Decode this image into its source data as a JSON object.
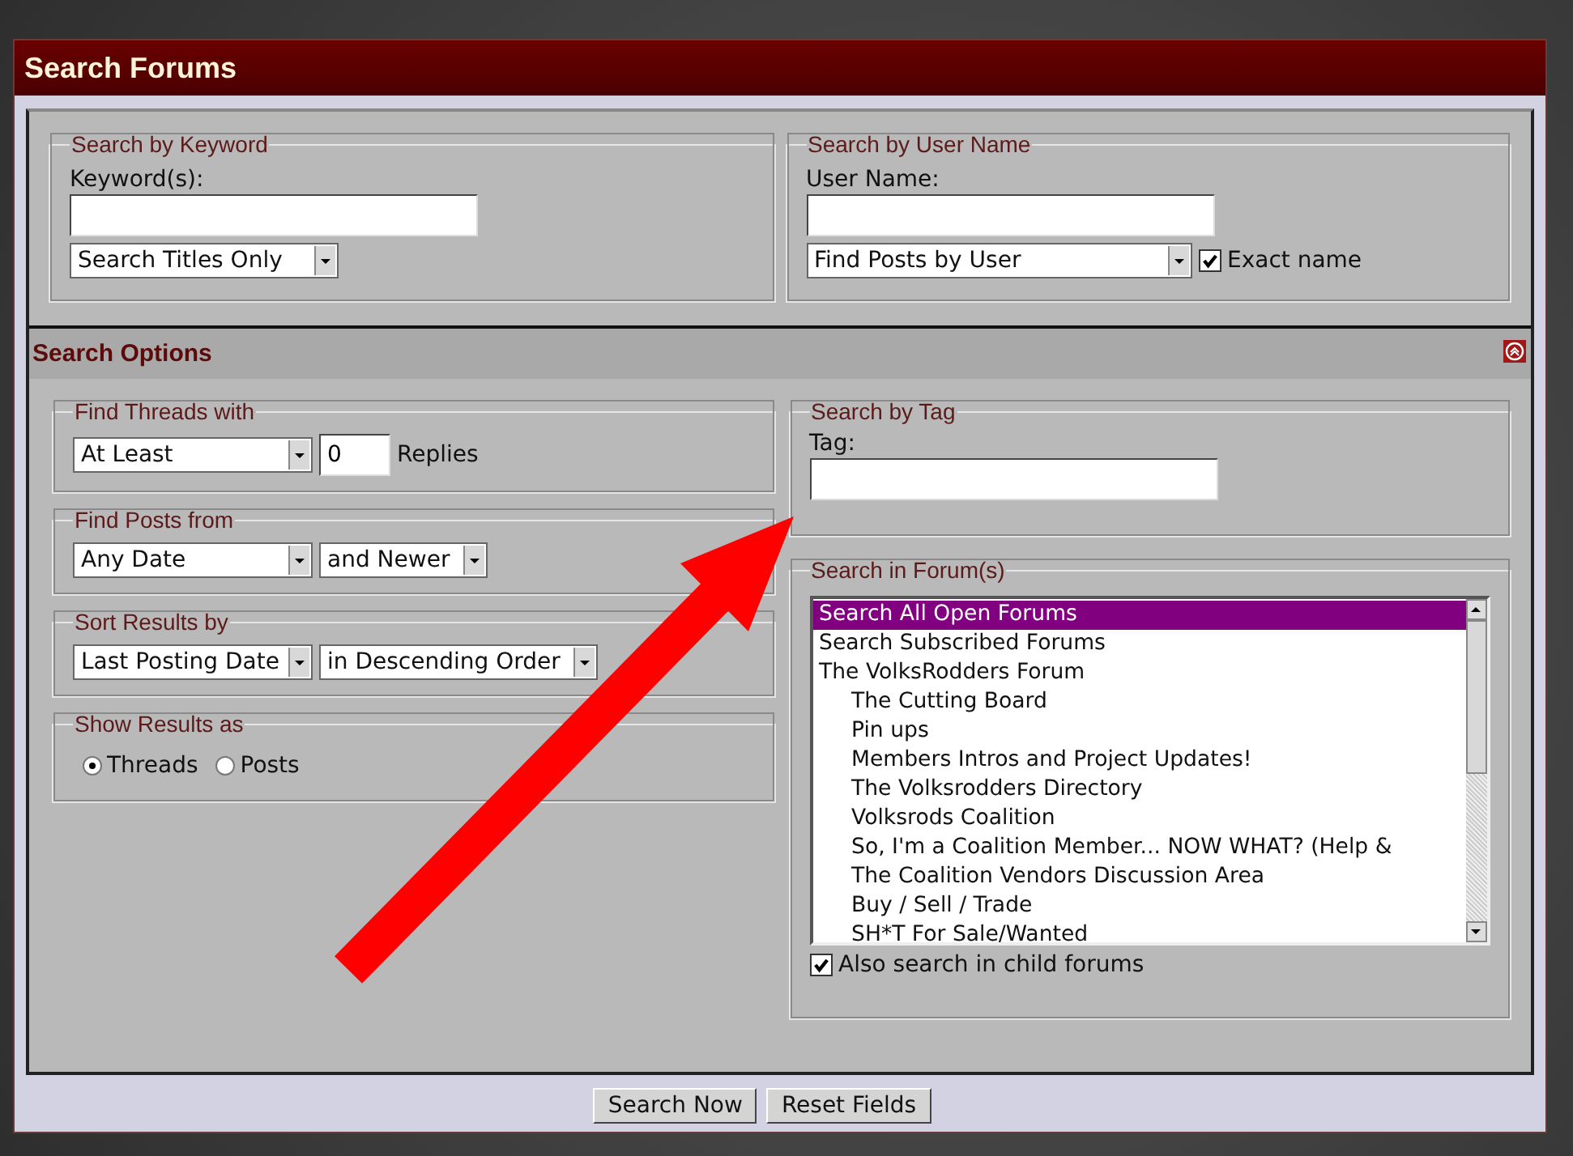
{
  "window": {
    "title": "Search Forums"
  },
  "keyword_section": {
    "legend": "Search by Keyword",
    "label": "Keyword(s):",
    "mode_select": "Search Titles Only"
  },
  "user_section": {
    "legend": "Search by User Name",
    "label": "User Name:",
    "mode_select": "Find Posts by User",
    "exact_name": {
      "label": "Exact name",
      "checked": true
    }
  },
  "options_header": {
    "title": "Search Options"
  },
  "find_threads": {
    "legend": "Find Threads with",
    "select": "At Least",
    "count": "0",
    "unit": "Replies"
  },
  "find_posts": {
    "legend": "Find Posts from",
    "date_select": "Any Date",
    "direction_select": "and Newer"
  },
  "sort": {
    "legend": "Sort Results by",
    "field_select": "Last Posting Date",
    "order_select": "in Descending Order"
  },
  "show_as": {
    "legend": "Show Results as",
    "options": [
      {
        "label": "Threads",
        "selected": true
      },
      {
        "label": "Posts",
        "selected": false
      }
    ]
  },
  "tag_section": {
    "legend": "Search by Tag",
    "label": "Tag:"
  },
  "forum_section": {
    "legend": "Search in Forum(s)",
    "forums": [
      {
        "label": "Search All Open Forums",
        "selected": true
      },
      {
        "label": "Search Subscribed Forums",
        "selected": false
      },
      {
        "label": "The VolksRodders Forum",
        "selected": false,
        "children": [
          {
            "label": "The Cutting Board",
            "selected": false
          },
          {
            "label": "Pin ups",
            "selected": false
          },
          {
            "label": "Members Intros and Project Updates!",
            "selected": false
          },
          {
            "label": "The Volksrodders Directory",
            "selected": false
          },
          {
            "label": "Volksrods Coalition",
            "selected": false
          },
          {
            "label": "So, I'm a Coalition Member... NOW WHAT? (Help &",
            "selected": false
          },
          {
            "label": "The Coalition Vendors Discussion Area",
            "selected": false
          },
          {
            "label": "Buy / Sell / Trade",
            "selected": false
          },
          {
            "label": "SH*T For Sale/Wanted",
            "selected": false
          }
        ]
      }
    ],
    "child_forums": {
      "label": "Also search in child forums",
      "checked": true
    }
  },
  "buttons": [
    "Search Now",
    "Reset Fields"
  ]
}
